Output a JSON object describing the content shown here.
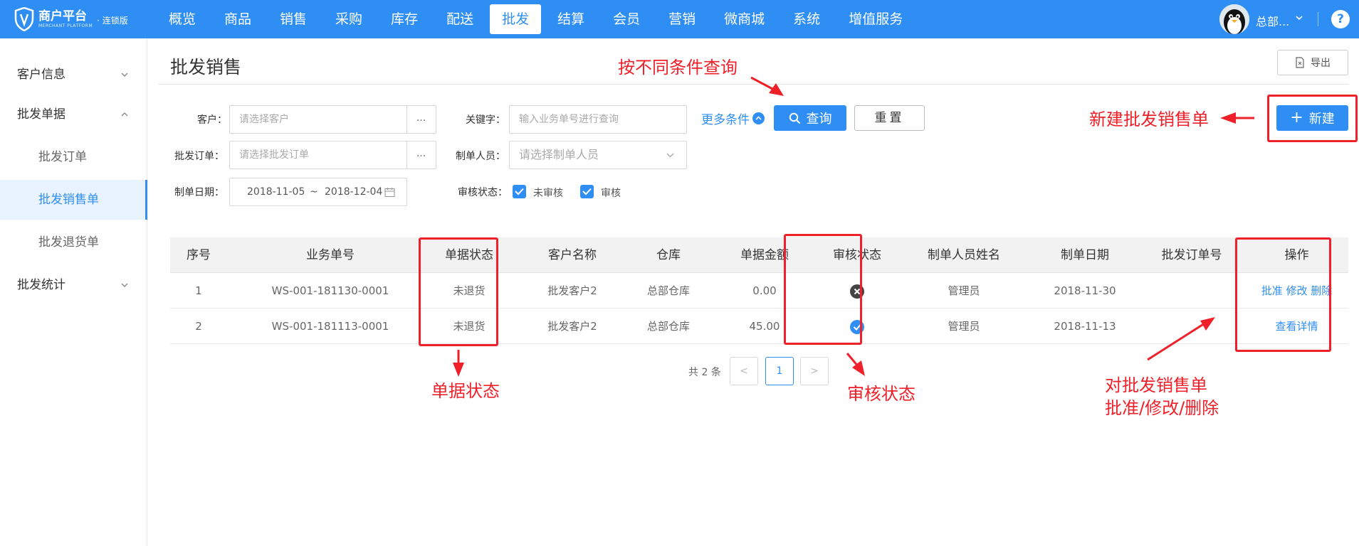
{
  "brand": {
    "title": "商户平台",
    "subtitle": "MERCHANT PLATFORM",
    "edition": "· 连锁版"
  },
  "nav": [
    {
      "label": "概览"
    },
    {
      "label": "商品"
    },
    {
      "label": "销售"
    },
    {
      "label": "采购"
    },
    {
      "label": "库存"
    },
    {
      "label": "配送"
    },
    {
      "label": "批发",
      "active": true
    },
    {
      "label": "结算"
    },
    {
      "label": "会员"
    },
    {
      "label": "营销"
    },
    {
      "label": "微商城"
    },
    {
      "label": "系统"
    },
    {
      "label": "增值服务"
    }
  ],
  "user": {
    "name": "总部...",
    "help": "?"
  },
  "sidebar": {
    "customer_info": "客户信息",
    "wholesale_docs": "批发单据",
    "wholesale_order": "批发订单",
    "wholesale_sales": "批发销售单",
    "wholesale_return": "批发退货单",
    "wholesale_stats": "批发统计"
  },
  "page": {
    "title": "批发销售",
    "export_label": "导出"
  },
  "filters": {
    "customer_label": "客户：",
    "customer_placeholder": "请选择客户",
    "keyword_label": "关键字：",
    "keyword_placeholder": "输入业务单号进行查询",
    "order_label": "批发订单：",
    "order_placeholder": "请选择批发订单",
    "maker_label": "制单人员：",
    "maker_placeholder": "请选择制单人员",
    "date_label": "制单日期：",
    "date_from": "2018-11-05",
    "date_sep": "~",
    "date_to": "2018-12-04",
    "audit_label": "审核状态：",
    "unaudited": "未审核",
    "audited": "审核",
    "dots": "...",
    "more": "更多条件",
    "query": "查询",
    "reset": "重置",
    "new": "新建"
  },
  "table": {
    "headers": [
      "序号",
      "业务单号",
      "单据状态",
      "客户名称",
      "仓库",
      "单据金额",
      "审核状态",
      "制单人员姓名",
      "制单日期",
      "批发订单号",
      "操作"
    ],
    "rows": [
      {
        "no": "1",
        "doc_no": "WS-001-181130-0001",
        "status": "未退货",
        "customer": "批发客户2",
        "warehouse": "总部仓库",
        "amount": "0.00",
        "audit": "rejected-icon",
        "maker": "管理员",
        "date": "2018-11-30",
        "order_no": "",
        "ops": [
          "批准",
          "修改",
          "删除"
        ]
      },
      {
        "no": "2",
        "doc_no": "WS-001-181113-0001",
        "status": "未退货",
        "customer": "批发客户2",
        "warehouse": "总部仓库",
        "amount": "45.00",
        "audit": "approved-icon",
        "maker": "管理员",
        "date": "2018-11-13",
        "order_no": "",
        "ops": [
          "查看详情"
        ]
      }
    ]
  },
  "pagination": {
    "total": "共 2 条",
    "prev": "<",
    "current": "1",
    "next": ">"
  },
  "annotations": {
    "query": "按不同条件查询",
    "new": "新建批发销售单",
    "doc_status": "单据状态",
    "audit_status": "审核状态",
    "ops_line1": "对批发销售单",
    "ops_line2": "批准/修改/删除"
  },
  "colors": {
    "primary": "#2f8ef4",
    "annotation": "#f0202a"
  }
}
